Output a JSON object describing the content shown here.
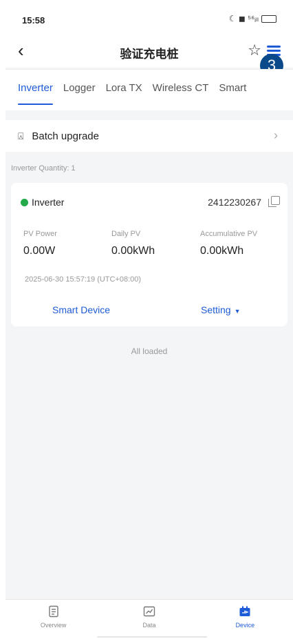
{
  "status_bar": {
    "time": "15:58",
    "icons": "☾ ◼ ⁵⁶ᵢₗₗ"
  },
  "header": {
    "title": "验证充电桩",
    "back_icon": "chevron-left-icon",
    "favorite_icon": "star-icon",
    "menu_icon": "menu-icon",
    "step_badge": "3"
  },
  "tabs": [
    {
      "label": "Inverter",
      "active": true
    },
    {
      "label": "Logger",
      "active": false
    },
    {
      "label": "Lora TX",
      "active": false
    },
    {
      "label": "Wireless CT",
      "active": false
    },
    {
      "label": "Smart",
      "active": false
    }
  ],
  "batch_upgrade": {
    "label": "Batch upgrade"
  },
  "inverter_quantity": "Inverter Quantity: 1",
  "device_card": {
    "name": "Inverter",
    "status_color": "#21a94a",
    "serial": "2412230267",
    "metrics": [
      {
        "label": "PV Power",
        "value": "0.00W"
      },
      {
        "label": "Daily PV",
        "value": "0.00kWh"
      },
      {
        "label": "Accumulative PV",
        "value": "0.00kWh"
      }
    ],
    "timestamp": "2025-06-30 15:57:19 (UTC+08:00)",
    "smart_device_label": "Smart Device",
    "setting_label": "Setting"
  },
  "list_footer": "All loaded",
  "bottom_nav": [
    {
      "label": "Overview",
      "icon": "overview-icon",
      "active": false
    },
    {
      "label": "Data",
      "icon": "data-icon",
      "active": false
    },
    {
      "label": "Device",
      "icon": "device-icon",
      "active": true
    }
  ],
  "colors": {
    "accent": "#1e5bd6",
    "online": "#21a94a",
    "background": "#f4f5f7"
  }
}
